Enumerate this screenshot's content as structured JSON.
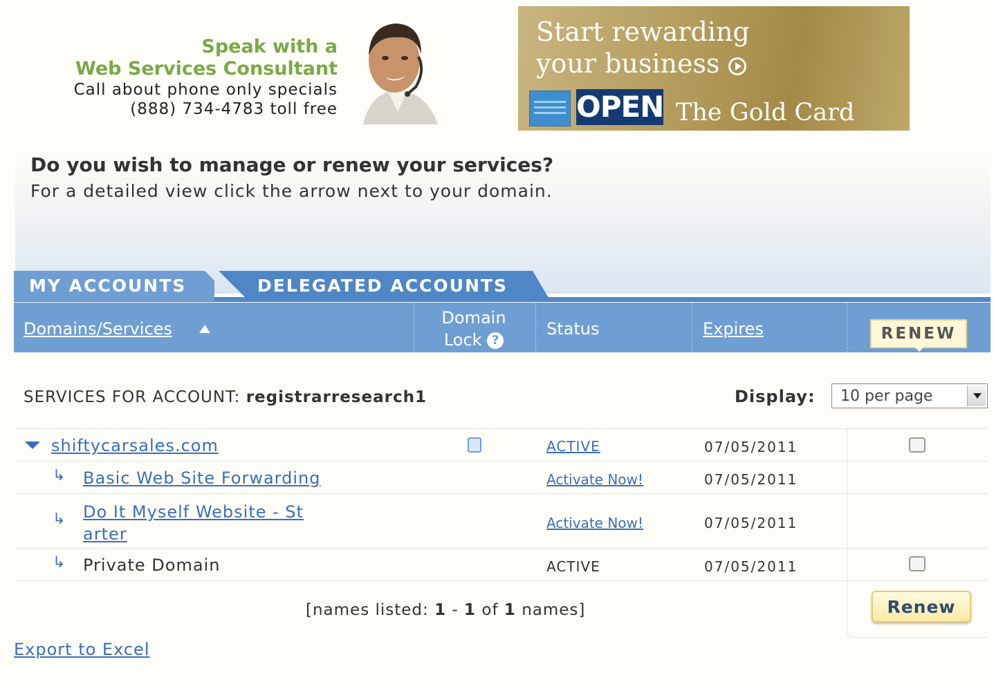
{
  "promo": {
    "line1": "Speak with a",
    "line2": "Web Services Consultant",
    "line3": "Call about phone only specials",
    "line4": "(888) 734-4783 toll free"
  },
  "ad": {
    "headline1": "Start rewarding",
    "headline2": "your business",
    "open": "OPEN",
    "card": "The Gold Card"
  },
  "intro": {
    "question": "Do you wish to manage or renew your services?",
    "hint": "For a detailed view click the arrow next to your domain."
  },
  "tabs": [
    {
      "label": "MY ACCOUNTS"
    },
    {
      "label": "DELEGATED ACCOUNTS"
    }
  ],
  "header": {
    "domains": "Domains/Services",
    "domain_lock_1": "Domain",
    "domain_lock_2": "Lock",
    "status": "Status",
    "expires": "Expires",
    "renew": "RENEW"
  },
  "services": {
    "label": "SERVICES FOR ACCOUNT:",
    "account": "registrarresearch1",
    "display_label": "Display:",
    "display_value": "10 per page"
  },
  "rows": [
    {
      "name": "shiftycarsales.com",
      "status": "ACTIVE",
      "expires": "07/05/2011"
    },
    {
      "name": "Basic Web Site Forwarding",
      "status": "Activate Now!",
      "expires": "07/05/2011"
    },
    {
      "name_1": "Do It Myself Website - St",
      "name_2": "arter",
      "status": "Activate Now!",
      "expires": "07/05/2011"
    },
    {
      "name": "Private Domain",
      "status": "ACTIVE",
      "expires": "07/05/2011"
    }
  ],
  "pagination": {
    "prefix": "[names listed:",
    "from": "1",
    "dash": "-",
    "to": "1",
    "of": "of",
    "total": "1",
    "suffix": "names]"
  },
  "renew_button": "Renew",
  "export": "Export to Excel",
  "colors": {
    "tab_blue": "#6f9fd2",
    "tab_dark": "#4f86c6",
    "link": "#3a6fb7",
    "green": "#7aa94a"
  }
}
